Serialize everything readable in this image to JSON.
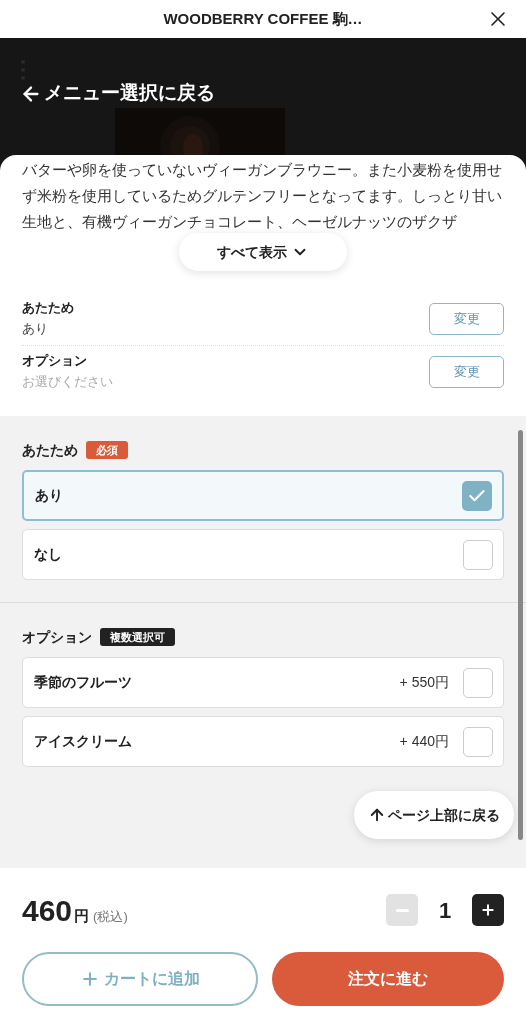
{
  "browser_bar": {
    "title": "WOODBERRY COFFEE 駒…"
  },
  "back_link": "メニュー選択に戻る",
  "description": "バターや卵を使っていないヴィーガンブラウニー。また小麦粉を使用せず米粉を使用しているためグルテンフリーとなってます。しっとり甘い生地と、有機ヴィーガンチョコレート、ヘーゼルナッツのザクザ",
  "show_all": "すべて表示",
  "summary": [
    {
      "name": "あたため",
      "value": "あり",
      "kind": "value",
      "button": "変更"
    },
    {
      "name": "オプション",
      "value": "お選びください",
      "kind": "prompt",
      "button": "変更"
    }
  ],
  "groups": [
    {
      "title": "あたため",
      "badge": {
        "label": "必須",
        "kind": "required"
      },
      "options": [
        {
          "label": "あり",
          "checked": true
        },
        {
          "label": "なし",
          "checked": false
        }
      ]
    },
    {
      "title": "オプション",
      "badge": {
        "label": "複数選択可",
        "kind": "multi"
      },
      "options": [
        {
          "label": "季節のフルーツ",
          "price": "+ 550円",
          "checked": false
        },
        {
          "label": "アイスクリーム",
          "price": "+ 440円",
          "checked": false
        }
      ]
    }
  ],
  "back_to_top": "ページ上部に戻る",
  "footer": {
    "price": "460",
    "unit": "円",
    "tax_note": "(税込)",
    "quantity": "1",
    "decrement_disabled": true,
    "add_to_cart": "カートに追加",
    "checkout": "注文に進む"
  }
}
